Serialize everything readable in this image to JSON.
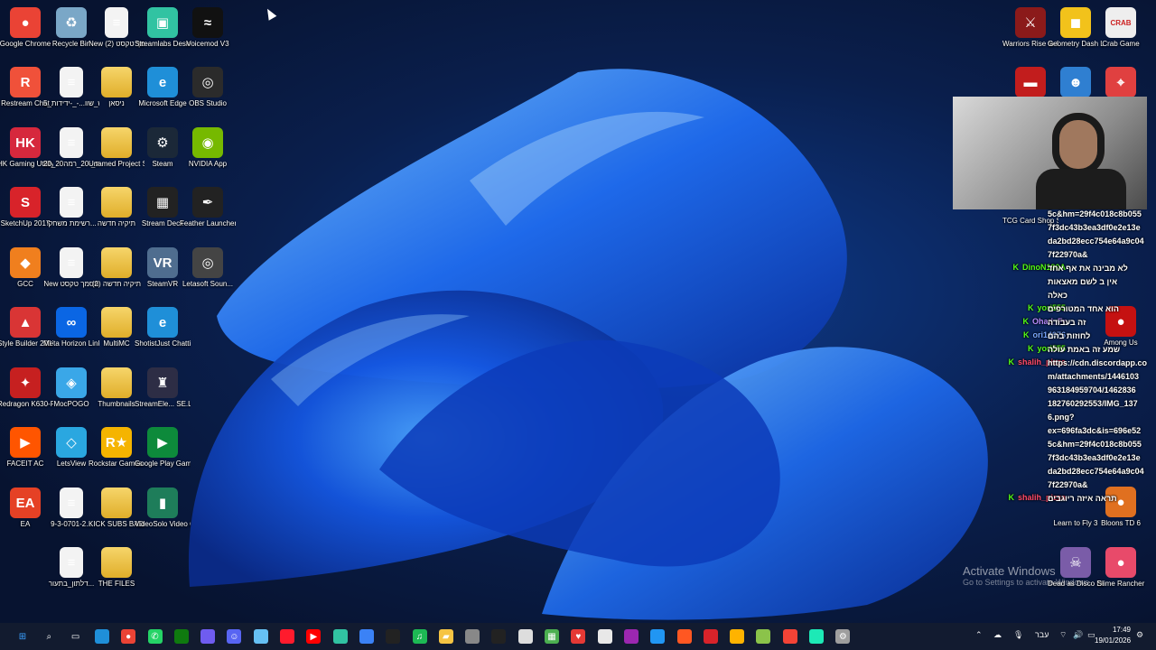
{
  "desktop_icons_left": [
    {
      "label": "Google Chrome",
      "icon": "chrome-icon",
      "glyph": "●",
      "color": "#ea4335"
    },
    {
      "label": "Recycle Bin",
      "icon": "recycle-bin-icon",
      "glyph": "♻",
      "color": "#7aa7c7"
    },
    {
      "label": "New מסמך טקסט (2)",
      "icon": "text-document-icon",
      "glyph": "≡",
      "color": "doc"
    },
    {
      "label": "Streamlabs Desktop",
      "icon": "streamlabs-icon",
      "glyph": "▣",
      "color": "#31c3a2"
    },
    {
      "label": "Voicemod V3",
      "icon": "voicemod-icon",
      "glyph": "≈",
      "color": "#111"
    },
    {
      "label": "Restream Chat",
      "icon": "restream-icon",
      "glyph": "R",
      "color": "#f0513a"
    },
    {
      "label": "משולש_שוו...-_-ידידות_5",
      "icon": "document-icon",
      "glyph": "≡",
      "color": "doc"
    },
    {
      "label": "ניסאן",
      "icon": "folder-icon",
      "glyph": "",
      "color": "folder"
    },
    {
      "label": "Microsoft Edge",
      "icon": "edge-icon",
      "glyph": "e",
      "color": "#1f8fd8"
    },
    {
      "label": "OBS Studio",
      "icon": "obs-icon",
      "glyph": "◎",
      "color": "#2b2b2b"
    },
    {
      "label": "HK Gaming Utility",
      "icon": "hk-gaming-icon",
      "glyph": "HK",
      "color": "#d6283d"
    },
    {
      "label": "20_נוסחאות_-20_רמה20...",
      "icon": "document-icon",
      "glyph": "≡",
      "color": "doc"
    },
    {
      "label": "Unamed Project So...",
      "icon": "folder-icon",
      "glyph": "",
      "color": "folder"
    },
    {
      "label": "Steam",
      "icon": "steam-icon",
      "glyph": "⚙",
      "color": "#1b2838"
    },
    {
      "label": "NVIDIA App",
      "icon": "nvidia-icon",
      "glyph": "◉",
      "color": "#76b900"
    },
    {
      "label": "SketchUp 2017",
      "icon": "sketchup-icon",
      "glyph": "S",
      "color": "#d8232a"
    },
    {
      "label": "רשימת משחקי...",
      "icon": "text-document-icon",
      "glyph": "≡",
      "color": "doc"
    },
    {
      "label": "תיקיה חדשה",
      "icon": "folder-icon",
      "glyph": "",
      "color": "folder"
    },
    {
      "label": "Stream Deck",
      "icon": "stream-deck-icon",
      "glyph": "▦",
      "color": "#222"
    },
    {
      "label": "Feather Launcher",
      "icon": "feather-icon",
      "glyph": "✒",
      "color": "#222"
    },
    {
      "label": "GCC",
      "icon": "gcc-icon",
      "glyph": "◆",
      "color": "#f07f1e"
    },
    {
      "label": "New מסמך טקסט",
      "icon": "text-document-icon",
      "glyph": "≡",
      "color": "doc"
    },
    {
      "label": "תיקיה חדשה (2)",
      "icon": "folder-icon",
      "glyph": "",
      "color": "folder"
    },
    {
      "label": "SteamVR",
      "icon": "steamvr-icon",
      "glyph": "VR",
      "color": "#4f6d8f"
    },
    {
      "label": "Letasoft Soun...",
      "icon": "speaker-icon",
      "glyph": "◎",
      "color": "#444"
    },
    {
      "label": "Style Builder 2017",
      "icon": "style-builder-icon",
      "glyph": "▲",
      "color": "#d93535"
    },
    {
      "label": "Meta Horizon Link",
      "icon": "meta-icon",
      "glyph": "∞",
      "color": "#0a66e4"
    },
    {
      "label": "MultiMC",
      "icon": "folder-icon",
      "glyph": "",
      "color": "folder"
    },
    {
      "label": "ShotistJust Chatting56",
      "icon": "edge-icon",
      "glyph": "e",
      "color": "#1f8fd8"
    },
    {
      "label": "",
      "icon": "blank-icon",
      "glyph": "",
      "color": "none"
    },
    {
      "label": "Redragon K630-RGB",
      "icon": "redragon-icon",
      "glyph": "✦",
      "color": "#c62020"
    },
    {
      "label": "MocPOGO",
      "icon": "mocpogo-icon",
      "glyph": "◈",
      "color": "#3aa7e8"
    },
    {
      "label": "Thumbnails",
      "icon": "folder-icon",
      "glyph": "",
      "color": "folder"
    },
    {
      "label": "StreamEle... SE.Live",
      "icon": "streamelements-icon",
      "glyph": "♜",
      "color": "#2d2d45"
    },
    {
      "label": "",
      "icon": "blank-icon",
      "glyph": "",
      "color": "none"
    },
    {
      "label": "FACEIT AC",
      "icon": "faceit-icon",
      "glyph": "▶",
      "color": "#ff5500"
    },
    {
      "label": "LetsView",
      "icon": "letsview-icon",
      "glyph": "◇",
      "color": "#2aa7e0"
    },
    {
      "label": "Rockstar Games ...",
      "icon": "rockstar-icon",
      "glyph": "R★",
      "color": "#f5b400"
    },
    {
      "label": "Google Play Games",
      "icon": "google-play-games-icon",
      "glyph": "▶",
      "color": "#0d8a3b"
    },
    {
      "label": "",
      "icon": "blank-icon",
      "glyph": "",
      "color": "none"
    },
    {
      "label": "EA",
      "icon": "ea-icon",
      "glyph": "EA",
      "color": "#e54125"
    },
    {
      "label": "9-3-0701-2...",
      "icon": "document-icon",
      "glyph": "≡",
      "color": "doc"
    },
    {
      "label": "KICK SUBS BADGES",
      "icon": "folder-icon",
      "glyph": "",
      "color": "folder"
    },
    {
      "label": "VideoSolo Video C...",
      "icon": "videosolo-icon",
      "glyph": "▮",
      "color": "#1e7d5a"
    },
    {
      "label": "",
      "icon": "blank-icon",
      "glyph": "",
      "color": "none"
    },
    {
      "label": "",
      "icon": "blank-icon",
      "glyph": "",
      "color": "none"
    },
    {
      "label": "דלתון_בתעור...",
      "icon": "document-icon",
      "glyph": "≡",
      "color": "doc"
    },
    {
      "label": "THE FILES",
      "icon": "folder-icon",
      "glyph": "",
      "color": "folder"
    }
  ],
  "desktop_icons_right": [
    {
      "label": "Warriors Rise to Glory",
      "icon": "warriors-icon",
      "glyph": "⚔",
      "color": "#8b1a1a"
    },
    {
      "label": "Geometry Dash Lite",
      "icon": "geometry-dash-icon",
      "glyph": "◼",
      "color": "#f2c21b"
    },
    {
      "label": "Crab Game",
      "icon": "crab-game-icon",
      "glyph": "CRAB",
      "color": "#eee"
    },
    {
      "label": "",
      "icon": "truck-game-icon",
      "glyph": "▬",
      "color": "#c21d1d"
    },
    {
      "label": "",
      "icon": "game-icon",
      "glyph": "☻",
      "color": "#2f7fd1"
    },
    {
      "label": "",
      "icon": "map-pin-icon",
      "glyph": "⌖",
      "color": "#e04040"
    },
    {
      "label": "TCG Card Shop Si...",
      "icon": "tcg-icon",
      "glyph": "",
      "color": "none"
    },
    {
      "label": "Among Us",
      "icon": "among-us-icon",
      "glyph": "●",
      "color": "#c51111"
    },
    {
      "label": "Learn to Fly 3",
      "icon": "learn-to-fly-icon",
      "glyph": "",
      "color": "none"
    },
    {
      "label": "Bloons TD 6",
      "icon": "bloons-icon",
      "glyph": "●",
      "color": "#e07020"
    },
    {
      "label": "Dead as Disco Demo",
      "icon": "skull-icon",
      "glyph": "☠",
      "color": "#7a5ca8"
    },
    {
      "label": "Slime Rancher",
      "icon": "slime-icon",
      "glyph": "●",
      "color": "#e84a6a"
    }
  ],
  "overlay": {
    "chat_messages": [
      {
        "user": "",
        "text": "5c&hm=29f4c018c8b055"
      },
      {
        "user": "",
        "text": "7f3dc43b3ea3df0e2e13e"
      },
      {
        "user": "",
        "text": "da2bd28ecc754e64a9c04"
      },
      {
        "user": "",
        "text": "7f22970a&"
      },
      {
        "user": "DinoN190A",
        "text": "לא מבינה את אף אחד"
      },
      {
        "user": "",
        "text": "אין ב לשם מאצאות"
      },
      {
        "user": "",
        "text": "כאלה"
      },
      {
        "user": "yori555",
        "text": "הוא אחד המטורפים"
      },
      {
        "user": "Ohad_Fr",
        "text": "זה בעבודה"
      },
      {
        "user": "ori14976",
        "text": "לחוזות בהם"
      },
      {
        "user": "yori555",
        "text": "שמע זה באמת עולה"
      },
      {
        "user": "shalih_pizza",
        "text": "https://cdn.discordapp.co"
      },
      {
        "user": "",
        "text": "m/attachments/1446103"
      },
      {
        "user": "",
        "text": "963184959704/1462836"
      },
      {
        "user": "",
        "text": "182760292553/IMG_137"
      },
      {
        "user": "",
        "text": "6.png?"
      },
      {
        "user": "",
        "text": "ex=696fa3dc&is=696e52"
      },
      {
        "user": "",
        "text": "5c&hm=29f4c018c8b055"
      },
      {
        "user": "",
        "text": "7f3dc43b3ea3df0e2e13e"
      },
      {
        "user": "",
        "text": "da2bd28ecc754e64a9c04"
      },
      {
        "user": "",
        "text": "7f22970a&"
      },
      {
        "user": "shalih_pizza",
        "text": "תראה איזה ריוגבים"
      }
    ],
    "user_colors": {
      "DinoN190A": "#53fc18",
      "yori555": "#53fc18",
      "Ohad_Fr": "#b88cff",
      "ori14976": "#7aa7ff",
      "shalih_pizza": "#ff4a6a"
    }
  },
  "activate_windows": {
    "title": "Activate Windows",
    "subtitle": "Go to Settings to activate Windows."
  },
  "taskbar": {
    "apps": [
      "windows-start-icon",
      "search-icon",
      "task-view-icon",
      "edge-icon",
      "chrome-icon",
      "whatsapp-icon",
      "xbox-icon",
      "copilot-icon",
      "discord-icon",
      "steam-icon",
      "opera-icon",
      "youtube-icon",
      "streamlabs-icon",
      "store-icon",
      "terminal-icon",
      "spotify-icon",
      "file-explorer-icon",
      "app-icon",
      "capcut-icon",
      "close-app-icon",
      "minecraft-icon",
      "heart-app-icon",
      "notepad-icon",
      "video-app-icon",
      "photos-icon",
      "game-icon",
      "sketchup-icon",
      "file-icon",
      "minecraft-launcher-icon",
      "youtube-music-icon",
      "voicemod-icon",
      "settings-icon"
    ],
    "tray": {
      "language": "עבר",
      "time": "17:49",
      "date": "19/01/2026"
    }
  }
}
